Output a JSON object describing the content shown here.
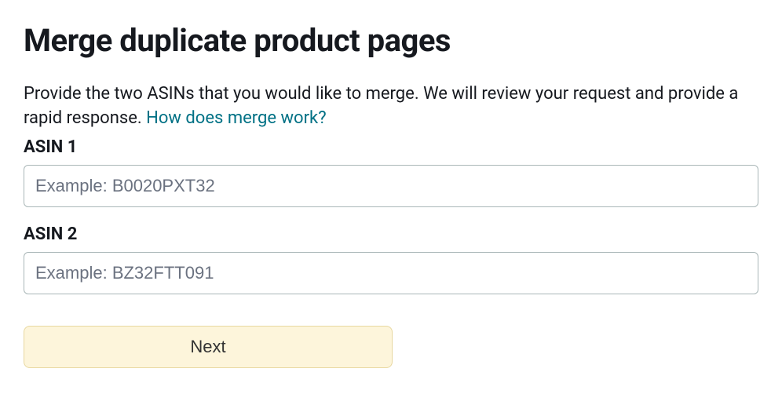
{
  "title": "Merge duplicate product pages",
  "intro": {
    "text1": "Provide the two ASINs that you would like to merge. We will review your request and provide a rapid response. ",
    "link": "How does merge work?"
  },
  "asin1": {
    "label": "ASIN 1",
    "placeholder": "Example: B0020PXT32",
    "value": ""
  },
  "asin2": {
    "label": "ASIN 2",
    "placeholder": "Example: BZ32FTT091",
    "value": ""
  },
  "nextLabel": "Next"
}
